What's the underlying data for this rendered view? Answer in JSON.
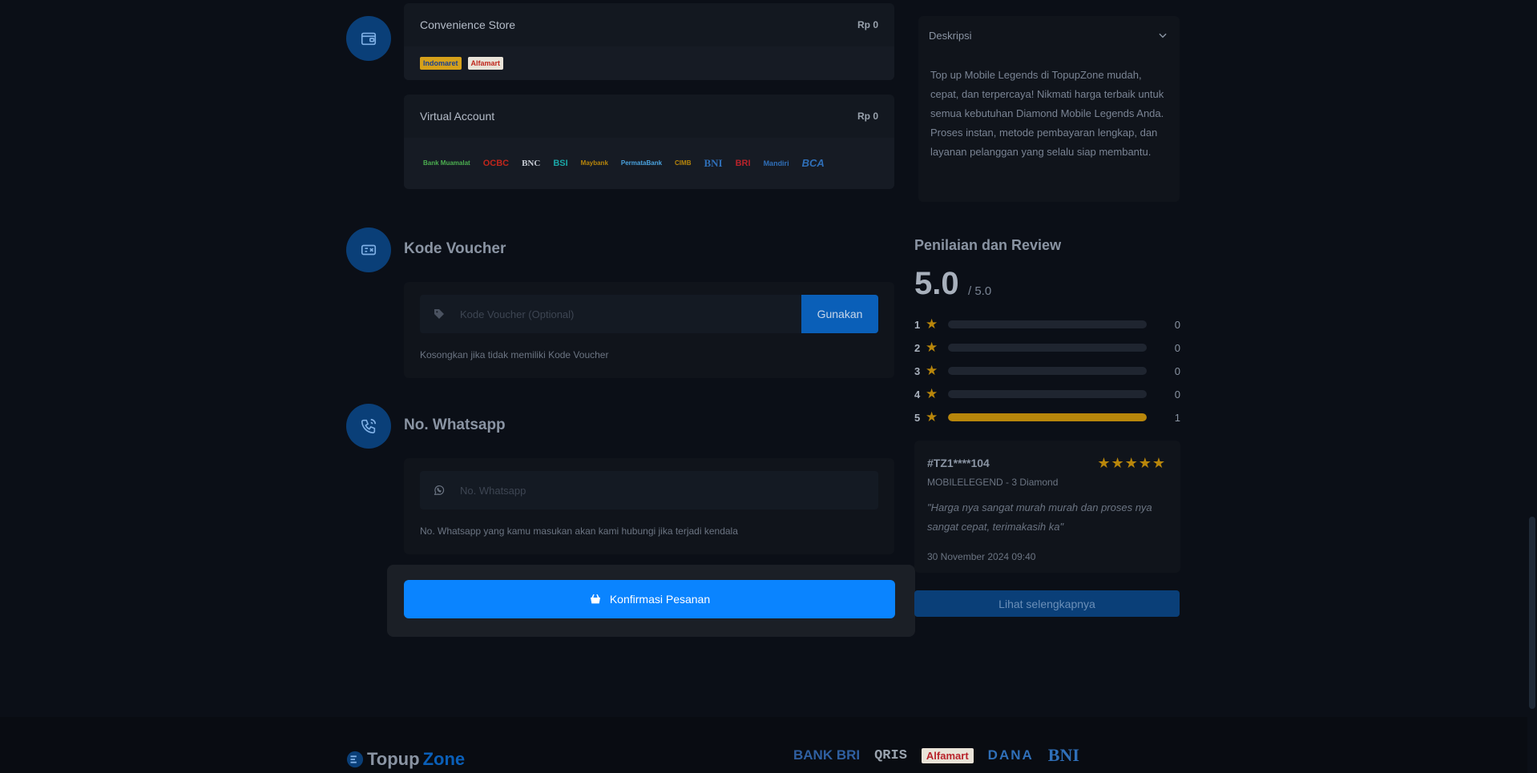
{
  "payment": {
    "groups": [
      {
        "name": "Convenience Store",
        "price": "Rp 0",
        "logos": [
          "Indomaret",
          "Alfamart"
        ]
      },
      {
        "name": "Virtual Account",
        "price": "Rp 0",
        "logos": [
          "Bank Muamalat",
          "OCBC",
          "BNC",
          "BSI",
          "Maybank",
          "PermataBank",
          "CIMB",
          "BNI",
          "BRI",
          "Mandiri",
          "BCA"
        ]
      }
    ]
  },
  "voucher": {
    "title": "Kode Voucher",
    "placeholder": "Kode Voucher (Optional)",
    "apply_label": "Gunakan",
    "hint": "Kosongkan jika tidak memiliki Kode Voucher"
  },
  "whatsapp": {
    "title": "No. Whatsapp",
    "placeholder": "No. Whatsapp",
    "hint": "No. Whatsapp yang kamu masukan akan kami hubungi jika terjadi kendala"
  },
  "confirm": {
    "label": "Konfirmasi Pesanan"
  },
  "description": {
    "title": "Deskripsi",
    "text": "Top up Mobile Legends di TopupZone mudah, cepat, dan terpercaya! Nikmati harga terbaik untuk semua kebutuhan Diamond Mobile Legends Anda. Proses instan, metode pembayaran lengkap, dan layanan pelanggan yang selalu siap membantu."
  },
  "rating": {
    "title": "Penilaian dan Review",
    "score": "5.0",
    "max": "/ 5.0",
    "rows": [
      {
        "stars": "1",
        "count": "0",
        "fraction": 0
      },
      {
        "stars": "2",
        "count": "0",
        "fraction": 0
      },
      {
        "stars": "3",
        "count": "0",
        "fraction": 0
      },
      {
        "stars": "4",
        "count": "0",
        "fraction": 0
      },
      {
        "stars": "5",
        "count": "1",
        "fraction": 1
      }
    ]
  },
  "review": {
    "user": "#TZ1****104",
    "product": "MOBILELEGEND - 3 Diamond",
    "text": "\"Harga nya sangat murah murah dan proses nya sangat cepat, terimakasih ka\"",
    "date": "30 November 2024 09:40",
    "stars": 5,
    "more_label": "Lihat selengkapnya"
  },
  "footer": {
    "brand_a": "Topup",
    "brand_b": "Zone",
    "logos": [
      "BANK BRI",
      "QRIS",
      "Alfamart",
      "DANA",
      "BNI"
    ]
  },
  "colors": {
    "accent": "#0a84ff",
    "star": "#b8860b",
    "bg": "#0b0f17"
  }
}
